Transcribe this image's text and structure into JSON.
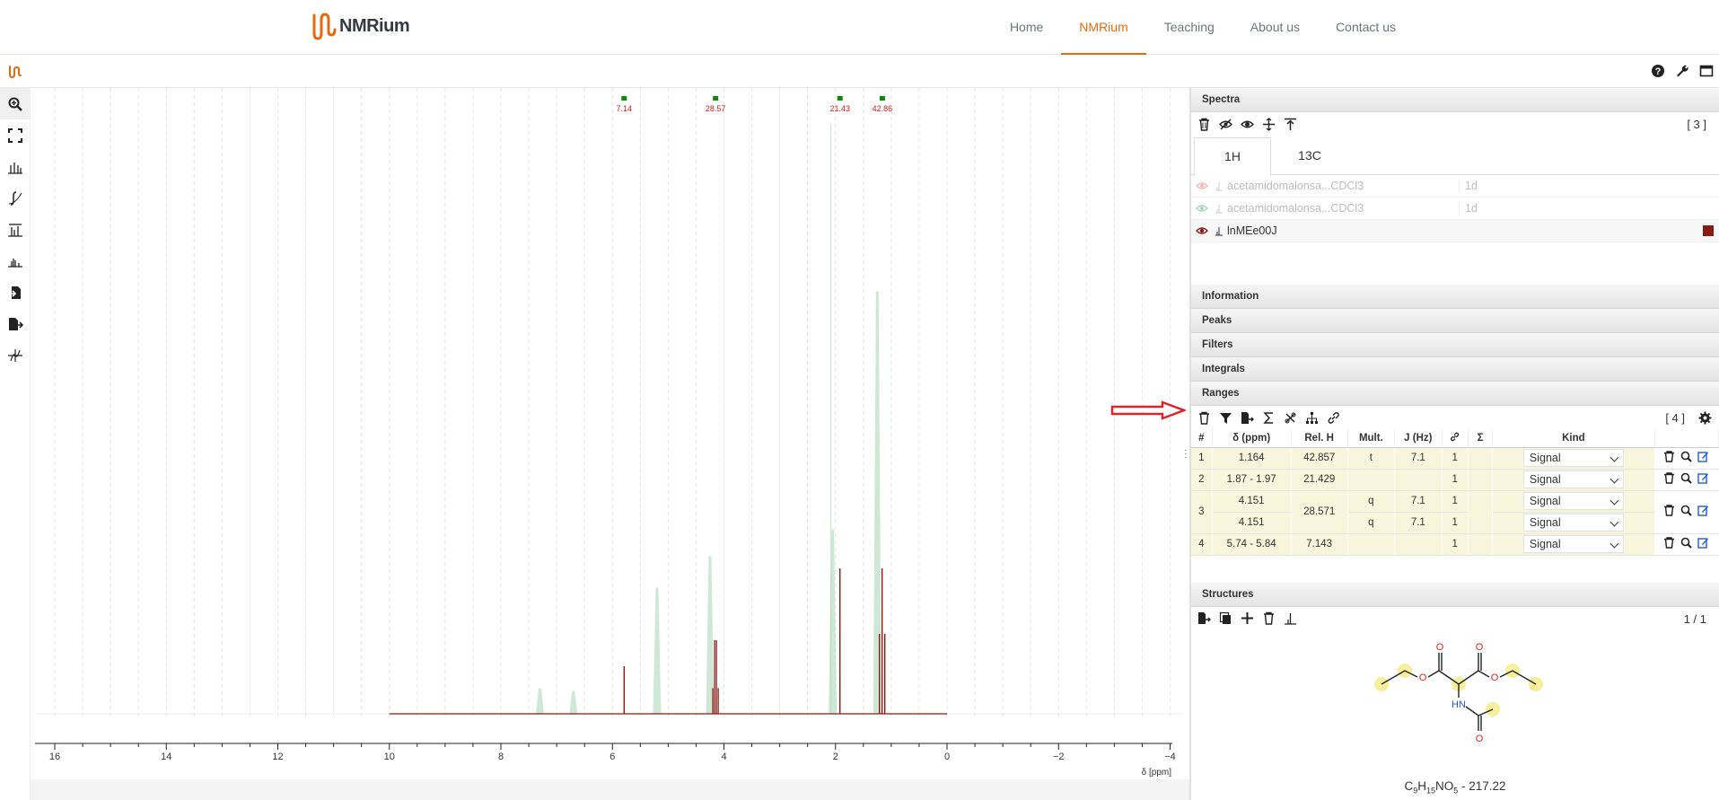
{
  "nav": {
    "brand_prefix": "NMR",
    "brand_suffix": "ium",
    "items": [
      {
        "label": "Home"
      },
      {
        "label": "NMRium"
      },
      {
        "label": "Teaching"
      },
      {
        "label": "About us"
      },
      {
        "label": "Contact us"
      }
    ],
    "active": "NMRium"
  },
  "left_toolbar": {
    "tools": [
      "zoom-icon",
      "full-view-icon",
      "peak-picking-icon",
      "integral-icon",
      "range-picking-icon",
      "multiplet-icon",
      "import-icon",
      "export-icon",
      "phase-correction-icon"
    ]
  },
  "spectrum_plot": {
    "x_axis_label": "δ [ppm]",
    "ticks": [
      "16",
      "14",
      "12",
      "10",
      "8",
      "6",
      "4",
      "2",
      "0",
      "−2",
      "−4"
    ],
    "range_labels": [
      {
        "label": "7.14",
        "ppm": 5.79
      },
      {
        "label": "28.57",
        "ppm": 4.15
      },
      {
        "label": "21.43",
        "ppm": 1.92
      },
      {
        "label": "42.86",
        "ppm": 1.16
      }
    ]
  },
  "chart_data": {
    "type": "line",
    "x_axis_label": "δ [ppm]",
    "xlim": [
      16.5,
      -4.1
    ],
    "series": [
      {
        "peaks_ppm": [
          1.164,
          1.92,
          4.151,
          5.79
        ]
      },
      {
        "peaks_ppm": [
          7.3,
          6.7,
          5.2,
          4.25,
          2.05,
          1.25
        ]
      }
    ]
  },
  "spectra_panel": {
    "title": "Spectra",
    "count": "[ 3 ]",
    "tabs": [
      {
        "label": "1H"
      },
      {
        "label": "13C"
      }
    ],
    "active_tab": "1H",
    "rows": [
      {
        "name": "acetamidomalonsa...CDCl3",
        "dim": "1d",
        "color": "#f4b7b7"
      },
      {
        "name": "acetamidomalonsa...CDCl3",
        "dim": "1d",
        "color": "#a8d5b8"
      },
      {
        "name": "lnMEe00J",
        "dim": "",
        "color": "#8b1a14"
      }
    ]
  },
  "sections": {
    "information": "Information",
    "peaks": "Peaks",
    "filters": "Filters",
    "integrals": "Integrals",
    "ranges": "Ranges",
    "structures": "Structures"
  },
  "ranges_panel": {
    "count": "[ 4 ]",
    "headers": {
      "num": "#",
      "delta": "δ (ppm)",
      "relh": "Rel. H",
      "mult": "Mult.",
      "j": "J (Hz)",
      "sigma": "Σ",
      "kind": "Kind"
    },
    "rows": [
      {
        "num": "1",
        "delta": "1.164",
        "relh": "42.857",
        "mult": "t",
        "j": "7.1",
        "link": "1",
        "kind": "Signal"
      },
      {
        "num": "2",
        "delta": "1.87 - 1.97",
        "relh": "21.429",
        "mult": "",
        "j": "",
        "link": "1",
        "kind": "Signal"
      },
      {
        "num": "3",
        "delta": "4.151",
        "relh": "28.571",
        "mult": "q",
        "j": "7.1",
        "link": "1",
        "kind": "Signal"
      },
      {
        "num": "",
        "delta": "4.151",
        "relh": "",
        "mult": "q",
        "j": "7.1",
        "link": "1",
        "kind": "Signal"
      },
      {
        "num": "4",
        "delta": "5.74 - 5.84",
        "relh": "7.143",
        "mult": "",
        "j": "",
        "link": "1",
        "kind": "Signal"
      }
    ]
  },
  "structures_panel": {
    "pager": "1 / 1",
    "formula_c": "C",
    "formula_c_n": "9",
    "formula_h": "H",
    "formula_h_n": "15",
    "formula_no": "NO",
    "formula_o_n": "5",
    "formula_mass": " - 217.22",
    "atoms": {
      "o": "O",
      "hn": "HN"
    }
  },
  "colors": {
    "accent": "#e8690c",
    "spectrum_main": "#8b1a14",
    "spectrum_bg": "#a8d5b8",
    "range_marker": "#0b8a0b",
    "range_label": "#d11a1a",
    "range_row": "#f7f5dc",
    "annotation_arrow": "#d9262c"
  }
}
